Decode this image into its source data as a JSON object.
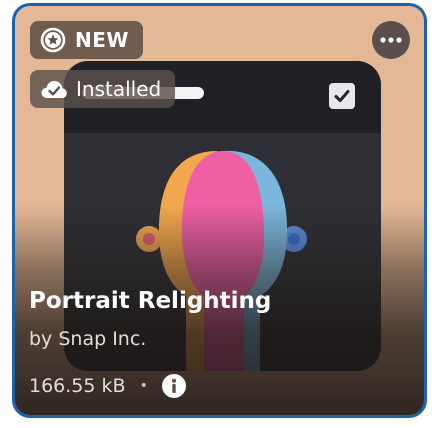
{
  "card": {
    "badge_new": "NEW",
    "badge_installed": "Installed",
    "title": "Portrait Relighting",
    "author": "by Snap Inc.",
    "size": "166.55 kB",
    "separator": "•"
  },
  "icons": {
    "new_badge_icon": "gear-star-icon",
    "installed_icon": "cloud-check-icon",
    "more_icon": "ellipsis-icon",
    "info_icon": "info-icon"
  },
  "colors": {
    "card_border": "#1a63b0",
    "card_background": "#e4b896",
    "badge_background": "#5f4e46",
    "portrait_pink": "#ee5fa3",
    "portrait_orange": "#f4a84e",
    "portrait_blue": "#7ab7dd"
  }
}
